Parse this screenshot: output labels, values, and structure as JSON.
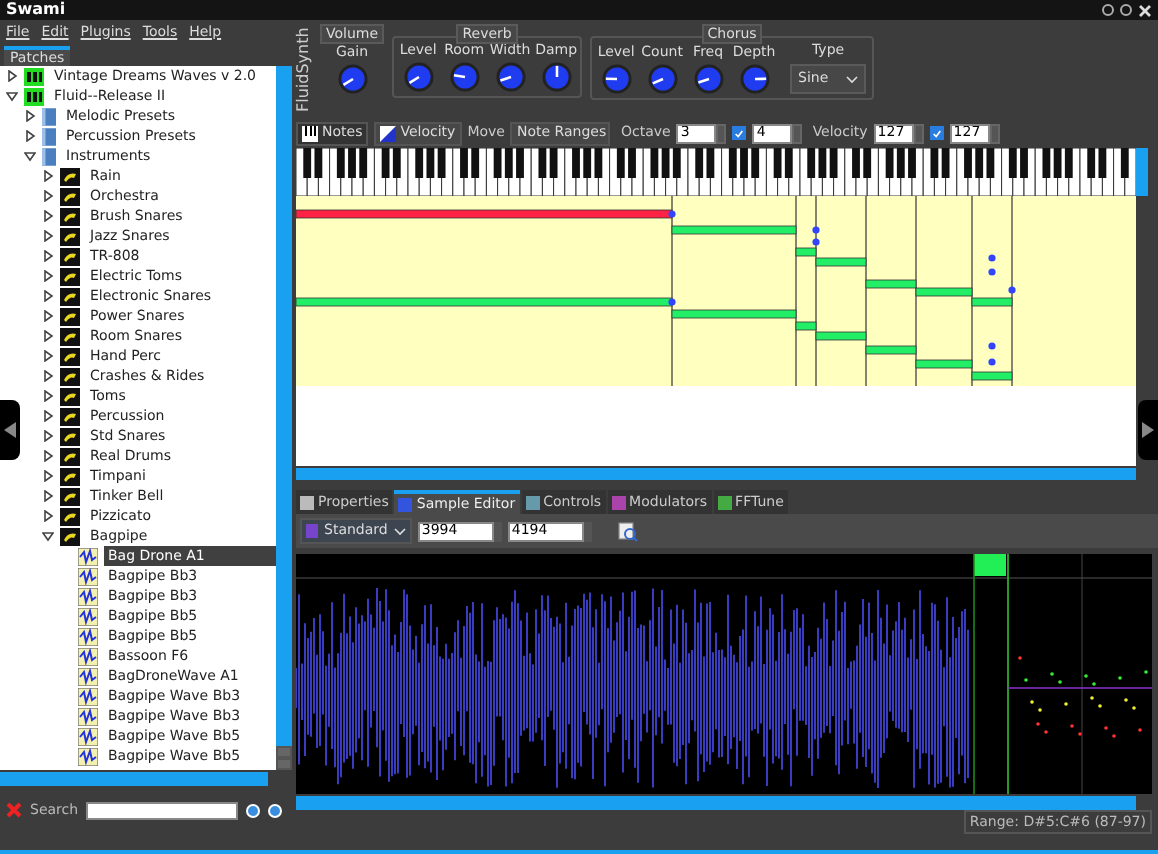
{
  "window": {
    "title": "Swami"
  },
  "menu": [
    "File",
    "Edit",
    "Plugins",
    "Tools",
    "Help"
  ],
  "left_tabs": [
    {
      "label": "Patches",
      "selected": true
    }
  ],
  "tree": [
    {
      "label": "Vintage Dreams Waves v 2.0",
      "kind": "soundfont",
      "expanded": false,
      "selected": false
    },
    {
      "label": "Fluid--Release II",
      "kind": "soundfont",
      "expanded": true,
      "selected": false,
      "children": [
        {
          "label": "Melodic Presets",
          "kind": "folder",
          "expanded": false,
          "selected": false
        },
        {
          "label": "Percussion Presets",
          "kind": "folder",
          "expanded": false,
          "selected": false
        },
        {
          "label": "Instruments",
          "kind": "folder",
          "expanded": true,
          "selected": false,
          "children": [
            {
              "label": "Rain",
              "kind": "instrument",
              "expanded": false,
              "selected": false
            },
            {
              "label": "Orchestra",
              "kind": "instrument",
              "expanded": false,
              "selected": false
            },
            {
              "label": "Brush Snares",
              "kind": "instrument",
              "expanded": false,
              "selected": false
            },
            {
              "label": "Jazz Snares",
              "kind": "instrument",
              "expanded": false,
              "selected": false
            },
            {
              "label": "TR-808",
              "kind": "instrument",
              "expanded": false,
              "selected": false
            },
            {
              "label": "Electric Toms",
              "kind": "instrument",
              "expanded": false,
              "selected": false
            },
            {
              "label": "Electronic Snares",
              "kind": "instrument",
              "expanded": false,
              "selected": false
            },
            {
              "label": "Power Snares",
              "kind": "instrument",
              "expanded": false,
              "selected": false
            },
            {
              "label": "Room Snares",
              "kind": "instrument",
              "expanded": false,
              "selected": false
            },
            {
              "label": "Hand Perc",
              "kind": "instrument",
              "expanded": false,
              "selected": false
            },
            {
              "label": "Crashes & Rides",
              "kind": "instrument",
              "expanded": false,
              "selected": false
            },
            {
              "label": "Toms",
              "kind": "instrument",
              "expanded": false,
              "selected": false
            },
            {
              "label": "Percussion",
              "kind": "instrument",
              "expanded": false,
              "selected": false
            },
            {
              "label": "Std Snares",
              "kind": "instrument",
              "expanded": false,
              "selected": false
            },
            {
              "label": "Real Drums",
              "kind": "instrument",
              "expanded": false,
              "selected": false
            },
            {
              "label": "Timpani",
              "kind": "instrument",
              "expanded": false,
              "selected": false
            },
            {
              "label": "Tinker Bell",
              "kind": "instrument",
              "expanded": false,
              "selected": false
            },
            {
              "label": "Pizzicato",
              "kind": "instrument",
              "expanded": false,
              "selected": false
            },
            {
              "label": "Bagpipe",
              "kind": "instrument",
              "expanded": true,
              "selected": false,
              "children": [
                {
                  "label": "Bag Drone A1",
                  "kind": "sample",
                  "selected": true
                },
                {
                  "label": "Bagpipe Bb3",
                  "kind": "sample",
                  "selected": false
                },
                {
                  "label": "Bagpipe Bb3",
                  "kind": "sample",
                  "selected": false
                },
                {
                  "label": "Bagpipe Bb5",
                  "kind": "sample",
                  "selected": false
                },
                {
                  "label": "Bagpipe Bb5",
                  "kind": "sample",
                  "selected": false
                },
                {
                  "label": "Bassoon F6",
                  "kind": "sample",
                  "selected": false
                },
                {
                  "label": "BagDroneWave A1",
                  "kind": "sample",
                  "selected": false
                },
                {
                  "label": "Bagpipe Wave Bb3",
                  "kind": "sample",
                  "selected": false
                },
                {
                  "label": "Bagpipe Wave Bb3",
                  "kind": "sample",
                  "selected": false
                },
                {
                  "label": "Bagpipe Wave Bb5",
                  "kind": "sample",
                  "selected": false
                },
                {
                  "label": "Bagpipe Wave Bb5",
                  "kind": "sample",
                  "selected": false
                }
              ]
            }
          ]
        }
      ]
    }
  ],
  "search": {
    "label": "Search"
  },
  "synth": {
    "title": "FluidSynth",
    "groups": [
      {
        "label": "Volume",
        "knobs": [
          {
            "label": "Gain",
            "level": 0.05
          }
        ]
      },
      {
        "label": "Reverb",
        "knobs": [
          {
            "label": "Level",
            "level": 0.05
          },
          {
            "label": "Room",
            "level": 0.2
          },
          {
            "label": "Width",
            "level": 0.1
          },
          {
            "label": "Damp",
            "level": 0.5
          }
        ]
      },
      {
        "label": "Chorus",
        "knobs": [
          {
            "label": "Level",
            "level": 0.17
          },
          {
            "label": "Count",
            "level": 0.08
          },
          {
            "label": "Freq",
            "level": 0.1
          },
          {
            "label": "Depth",
            "level": 0.83
          }
        ],
        "type": {
          "label": "Type",
          "value": "Sine"
        }
      }
    ]
  },
  "notes_toolbar": {
    "notes_button": "Notes",
    "velocity_button": "Velocity",
    "move_label": "Move",
    "move_value": "Note Ranges",
    "octave_label": "Octave",
    "octave_value": "3",
    "octave_checked": true,
    "octave_value_2": "4",
    "velocity_label": "Velocity",
    "velocity_value": "127",
    "velocity_checked": true,
    "velocity_value_2": "127"
  },
  "editor_tabs": [
    {
      "label": "Properties",
      "selected": false
    },
    {
      "label": "Sample Editor",
      "selected": true
    },
    {
      "label": "Controls",
      "selected": false
    },
    {
      "label": "Modulators",
      "selected": false
    },
    {
      "label": "FFTune",
      "selected": false
    }
  ],
  "sample_toolbar": {
    "mode": "Standard",
    "start": "3994",
    "end": "4194"
  },
  "status": "Range: D#5:C#6 (87-97)"
}
